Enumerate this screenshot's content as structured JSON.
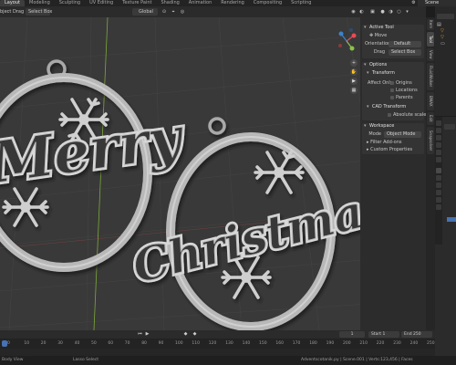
{
  "workspace_tabs": [
    "Layout",
    "Modeling",
    "Sculpting",
    "UV Editing",
    "Texture Paint",
    "Shading",
    "Animation",
    "Rendering",
    "Compositing",
    "Scripting"
  ],
  "active_workspace": "Layout",
  "scene": {
    "name": "Scene"
  },
  "viewport_header": {
    "object_mode_short": "bject",
    "drag_label": "Drag",
    "drag_value": "Select Box",
    "orientation": "Global"
  },
  "viewport": {
    "word_merry": "Merry",
    "word_christmas": "Christmas",
    "axis_colors": {
      "x": "#e74c57",
      "y": "#8bc34a",
      "z": "#3b83c9"
    }
  },
  "npanel": {
    "active_tool": {
      "title": "Active Tool",
      "tool_name": "Move",
      "orientation_label": "Orientation",
      "orientation_value": "Default",
      "drag_label": "Drag",
      "drag_value": "Select Box"
    },
    "options": {
      "title": "Options",
      "transform_title": "Transform",
      "affect_only_label": "Affect Only",
      "affect_origins": "Origins",
      "affect_locations": "Locations",
      "affect_parents": "Parents",
      "cad_title": "CAD Transform",
      "absolute_label": "Absolute scale"
    },
    "workspace": {
      "title": "Workspace",
      "mode_label": "Mode",
      "mode_value": "Object Mode",
      "filter_addons": "Filter Add-ons",
      "custom_properties": "Custom Properties"
    }
  },
  "vertical_tabs": [
    "Item",
    "Tool",
    "View",
    "FluidWalker",
    "BMAX",
    "Edit",
    "Snapsolver"
  ],
  "active_vertical_tab": "Tool",
  "timeline": {
    "ruler": [
      "0",
      "10",
      "20",
      "30",
      "40",
      "50",
      "60",
      "70",
      "80",
      "90",
      "100",
      "110",
      "120",
      "130",
      "140",
      "150",
      "160",
      "170",
      "180",
      "190",
      "200",
      "210",
      "220",
      "230",
      "240",
      "250"
    ],
    "current_frame": "1",
    "start_label": "Start",
    "start_value": "1",
    "end_label": "End",
    "end_value": "250"
  },
  "statusbar": {
    "left_hint": "Body View",
    "center_hint": "Lasso Select",
    "right_stats": "Adventscotanik.py | Scene.001 | Verts:123,456 | Faces"
  }
}
